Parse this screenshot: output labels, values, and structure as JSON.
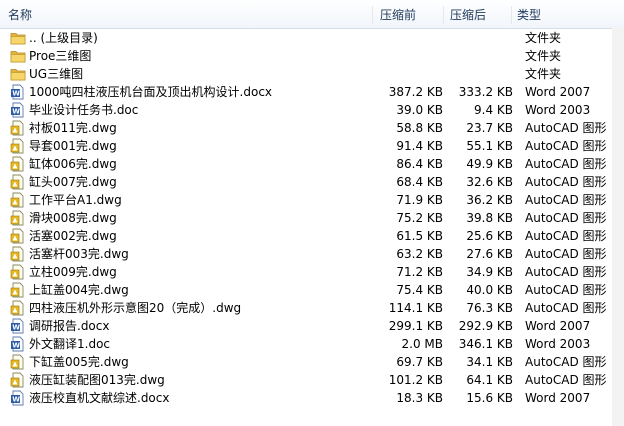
{
  "columns": {
    "name": "名称",
    "original": "压缩前",
    "compressed": "压缩后",
    "type": "类型"
  },
  "files": [
    {
      "icon": "folder-icon",
      "name": ".. (上级目录)",
      "original": "",
      "compressed": "",
      "type": "文件夹"
    },
    {
      "icon": "folder-icon",
      "name": "Proe三维图",
      "original": "",
      "compressed": "",
      "type": "文件夹"
    },
    {
      "icon": "folder-icon",
      "name": "UG三维图",
      "original": "",
      "compressed": "",
      "type": "文件夹"
    },
    {
      "icon": "word-doc-icon",
      "name": "1000吨四柱液压机台面及顶出机构设计.docx",
      "original": "387.2 KB",
      "compressed": "333.2 KB",
      "type": "Word 2007"
    },
    {
      "icon": "word-doc-icon",
      "name": "毕业设计任务书.doc",
      "original": "39.0 KB",
      "compressed": "9.4 KB",
      "type": "Word 2003"
    },
    {
      "icon": "dwg-file-icon",
      "name": "衬板011完.dwg",
      "original": "58.8 KB",
      "compressed": "23.7 KB",
      "type": "AutoCAD 图形"
    },
    {
      "icon": "dwg-file-icon",
      "name": "导套001完.dwg",
      "original": "91.4 KB",
      "compressed": "55.1 KB",
      "type": "AutoCAD 图形"
    },
    {
      "icon": "dwg-file-icon",
      "name": "缸体006完.dwg",
      "original": "86.4 KB",
      "compressed": "49.9 KB",
      "type": "AutoCAD 图形"
    },
    {
      "icon": "dwg-file-icon",
      "name": "缸头007完.dwg",
      "original": "68.4 KB",
      "compressed": "32.6 KB",
      "type": "AutoCAD 图形"
    },
    {
      "icon": "dwg-file-icon",
      "name": "工作平台A1.dwg",
      "original": "71.9 KB",
      "compressed": "36.2 KB",
      "type": "AutoCAD 图形"
    },
    {
      "icon": "dwg-file-icon",
      "name": "滑块008完.dwg",
      "original": "75.2 KB",
      "compressed": "39.8 KB",
      "type": "AutoCAD 图形"
    },
    {
      "icon": "dwg-file-icon",
      "name": "活塞002完.dwg",
      "original": "61.5 KB",
      "compressed": "25.6 KB",
      "type": "AutoCAD 图形"
    },
    {
      "icon": "dwg-file-icon",
      "name": "活塞杆003完.dwg",
      "original": "63.2 KB",
      "compressed": "27.6 KB",
      "type": "AutoCAD 图形"
    },
    {
      "icon": "dwg-file-icon",
      "name": "立柱009完.dwg",
      "original": "71.2 KB",
      "compressed": "34.9 KB",
      "type": "AutoCAD 图形"
    },
    {
      "icon": "dwg-file-icon",
      "name": "上缸盖004完.dwg",
      "original": "75.4 KB",
      "compressed": "40.0 KB",
      "type": "AutoCAD 图形"
    },
    {
      "icon": "dwg-file-icon",
      "name": "四柱液压机外形示意图20（完成）.dwg",
      "original": "114.1 KB",
      "compressed": "76.3 KB",
      "type": "AutoCAD 图形"
    },
    {
      "icon": "word-doc-icon",
      "name": "调研报告.docx",
      "original": "299.1 KB",
      "compressed": "292.9 KB",
      "type": "Word 2007"
    },
    {
      "icon": "word-doc-icon",
      "name": "外文翻译1.doc",
      "original": "2.0 MB",
      "compressed": "346.1 KB",
      "type": "Word 2003"
    },
    {
      "icon": "dwg-file-icon",
      "name": "下缸盖005完.dwg",
      "original": "69.7 KB",
      "compressed": "34.1 KB",
      "type": "AutoCAD 图形"
    },
    {
      "icon": "dwg-file-icon",
      "name": "液压缸装配图013完.dwg",
      "original": "101.2 KB",
      "compressed": "64.1 KB",
      "type": "AutoCAD 图形"
    },
    {
      "icon": "word-doc-icon",
      "name": "液压校直机文献综述.docx",
      "original": "18.3 KB",
      "compressed": "15.6 KB",
      "type": "Word 2007"
    }
  ]
}
